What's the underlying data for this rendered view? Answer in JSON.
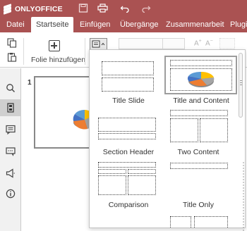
{
  "app": {
    "brand": "ONLYOFFICE",
    "colors": {
      "header": "#aa5252",
      "rail_active": "#cfcfcf",
      "selection": "#9d9d9d"
    }
  },
  "titlebar_icons": [
    "save-icon",
    "print-icon",
    "undo-icon",
    "redo-icon"
  ],
  "tabs": [
    {
      "label": "Datei",
      "active": false
    },
    {
      "label": "Startseite",
      "active": true
    },
    {
      "label": "Einfügen",
      "active": false
    },
    {
      "label": "Übergänge",
      "active": false
    },
    {
      "label": "Zusammenarbeit",
      "active": false
    },
    {
      "label": "Plugi",
      "active": false
    }
  ],
  "toolbar": {
    "add_slide_label": "Folie hinzufügen",
    "add_slide_caret": "⌄",
    "layout_caret": "⌃",
    "font_inc": "A",
    "font_dec": "A"
  },
  "rail": {
    "items": [
      "search-icon",
      "slides-icon",
      "comments-icon",
      "chat-icon",
      "feedback-icon",
      "about-icon"
    ],
    "active_index": 1
  },
  "slides_panel": {
    "slide_number": "1"
  },
  "layouts": {
    "items": [
      {
        "label": "Title Slide",
        "selected": false
      },
      {
        "label": "Title and Content",
        "selected": true
      },
      {
        "label": "Section Header",
        "selected": false
      },
      {
        "label": "Two Content",
        "selected": false
      },
      {
        "label": "Comparison",
        "selected": false
      },
      {
        "label": "Title Only",
        "selected": false
      }
    ]
  }
}
